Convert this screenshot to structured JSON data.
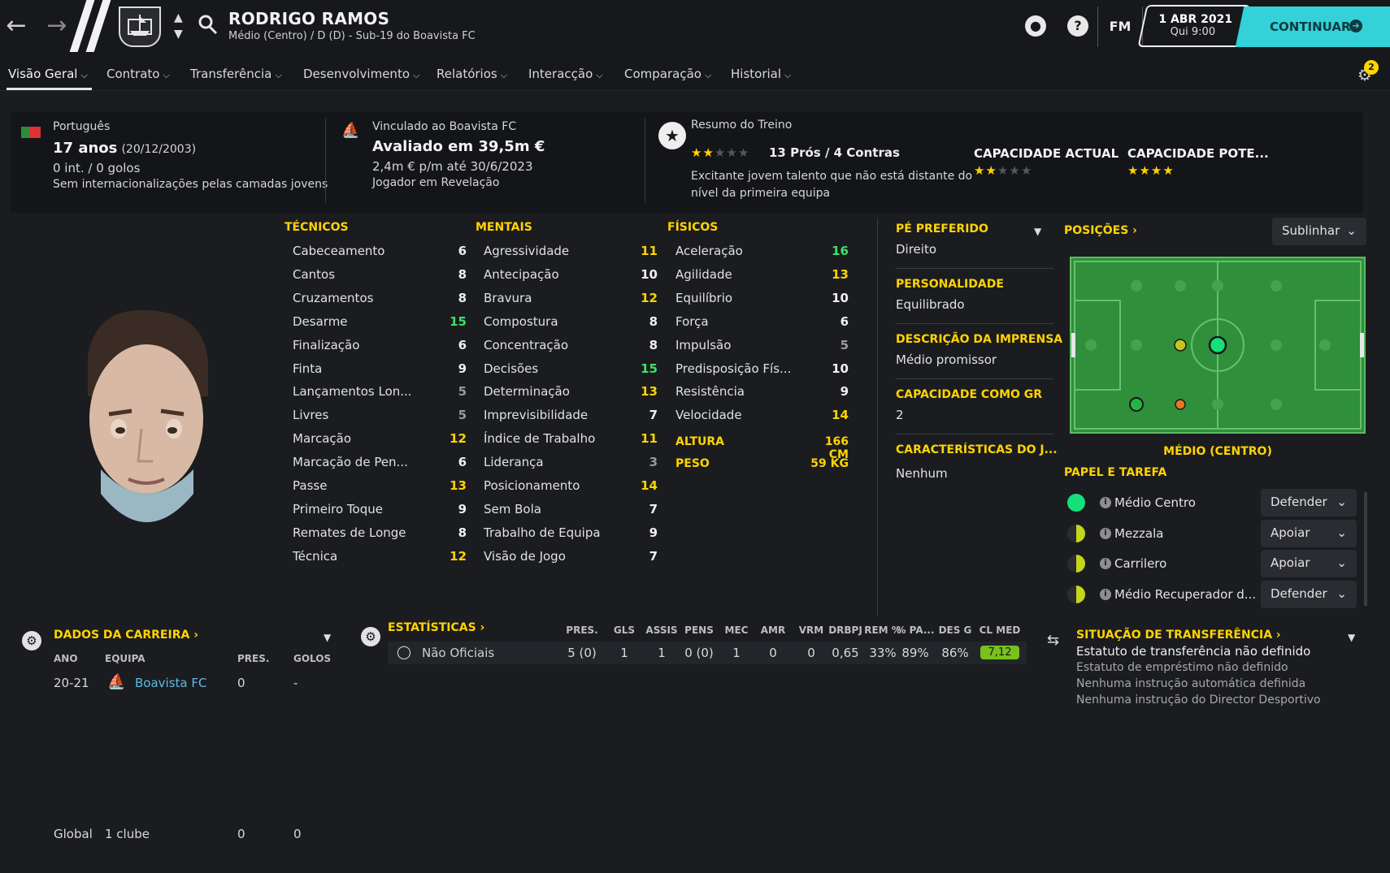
{
  "header": {
    "player_name": "RODRIGO RAMOS",
    "player_subtitle": "Médio (Centro) / D (D) - Sub-19 do Boavista FC",
    "date_main": "1 ABR 2021",
    "date_sub": "Qui 9:00",
    "continue_label": "CONTINUAR",
    "fm_label": "FM",
    "help_label": "?"
  },
  "tabs": [
    {
      "label": "Visão Geral"
    },
    {
      "label": "Contrato"
    },
    {
      "label": "Transferência"
    },
    {
      "label": "Desenvolvimento"
    },
    {
      "label": "Relatórios"
    },
    {
      "label": "Interacção"
    },
    {
      "label": "Comparação"
    },
    {
      "label": "Historial"
    }
  ],
  "notifications": "2",
  "summary": {
    "nationality": "Português",
    "age": "17 anos",
    "dob": "(20/12/2003)",
    "caps": "0 int. / 0 golos",
    "youth_caps": "Sem internacionalizações pelas camadas jovens",
    "club_link": "Vinculado ao Boavista FC",
    "value": "Avaliado em 39,5m €",
    "wage": "2,4m € p/m até 30/6/2023",
    "status": "Jogador em Revelação",
    "training_title": "Resumo do Treino",
    "pros_cons": "13 Prós / 4 Contras",
    "training_desc_1": "Excitante jovem talento que não está distante do",
    "training_desc_2": "nível da primeira equipa",
    "training_stars": 2,
    "current_ability_label": "CAPACIDADE ACTUAL",
    "current_ability_stars": 2,
    "potential_ability_label": "CAPACIDADE POTE...",
    "potential_ability_stars": 4
  },
  "attributes": {
    "technical_title": "TÉCNICOS",
    "technical": [
      {
        "name": "Cabeceamento",
        "value": "6"
      },
      {
        "name": "Cantos",
        "value": "8"
      },
      {
        "name": "Cruzamentos",
        "value": "8"
      },
      {
        "name": "Desarme",
        "value": "15"
      },
      {
        "name": "Finalização",
        "value": "6"
      },
      {
        "name": "Finta",
        "value": "9"
      },
      {
        "name": "Lançamentos Lon...",
        "value": "5"
      },
      {
        "name": "Livres",
        "value": "5"
      },
      {
        "name": "Marcação",
        "value": "12"
      },
      {
        "name": "Marcação de Pen...",
        "value": "6"
      },
      {
        "name": "Passe",
        "value": "13"
      },
      {
        "name": "Primeiro Toque",
        "value": "9"
      },
      {
        "name": "Remates de Longe",
        "value": "8"
      },
      {
        "name": "Técnica",
        "value": "12"
      }
    ],
    "mental_title": "MENTAIS",
    "mental": [
      {
        "name": "Agressividade",
        "value": "11"
      },
      {
        "name": "Antecipação",
        "value": "10"
      },
      {
        "name": "Bravura",
        "value": "12"
      },
      {
        "name": "Compostura",
        "value": "8"
      },
      {
        "name": "Concentração",
        "value": "8"
      },
      {
        "name": "Decisões",
        "value": "15"
      },
      {
        "name": "Determinação",
        "value": "13"
      },
      {
        "name": "Imprevisibilidade",
        "value": "7"
      },
      {
        "name": "Índice de Trabalho",
        "value": "11"
      },
      {
        "name": "Liderança",
        "value": "3"
      },
      {
        "name": "Posicionamento",
        "value": "14"
      },
      {
        "name": "Sem Bola",
        "value": "7"
      },
      {
        "name": "Trabalho de Equipa",
        "value": "9"
      },
      {
        "name": "Visão de Jogo",
        "value": "7"
      }
    ],
    "physical_title": "FÍSICOS",
    "physical": [
      {
        "name": "Aceleração",
        "value": "16"
      },
      {
        "name": "Agilidade",
        "value": "13"
      },
      {
        "name": "Equilíbrio",
        "value": "10"
      },
      {
        "name": "Força",
        "value": "6"
      },
      {
        "name": "Impulsão",
        "value": "5"
      },
      {
        "name": "Predisposição Fís...",
        "value": "10"
      },
      {
        "name": "Resistência",
        "value": "9"
      },
      {
        "name": "Velocidade",
        "value": "14"
      }
    ],
    "height_label": "ALTURA",
    "height_value": "166 CM",
    "weight_label": "PESO",
    "weight_value": "59 KG",
    "colors": {
      "high": "#3ee06a",
      "good": "#ffd400",
      "mid": "#f0f0f0",
      "low": "#9a9a9a"
    }
  },
  "profile": {
    "preferred_foot_label": "PÉ PREFERIDO",
    "preferred_foot_value": "Direito",
    "personality_label": "PERSONALIDADE",
    "personality_value": "Equilibrado",
    "press_label": "DESCRIÇÃO DA IMPRENSA",
    "press_value": "Médio promissor",
    "gk_label": "CAPACIDADE COMO GR",
    "gk_value": "2",
    "traits_label": "CARACTERÍSTICAS DO J...",
    "traits_value": "Nenhum"
  },
  "positions": {
    "title": "POSIÇÕES",
    "highlight_select": "Sublinhar",
    "position_label": "MÉDIO (CENTRO)",
    "roles_title": "PAPEL E TAREFA",
    "roles": [
      {
        "name": "Médio Centro",
        "duty": "Defender"
      },
      {
        "name": "Mezzala",
        "duty": "Apoiar"
      },
      {
        "name": "Carrilero",
        "duty": "Apoiar"
      },
      {
        "name": "Médio Recuperador d...",
        "duty": "Defender"
      }
    ]
  },
  "career": {
    "title": "DADOS DA CARREIRA",
    "col_year": "ANO",
    "col_team": "EQUIPA",
    "col_apps": "PRES.",
    "col_goals": "GOLOS",
    "rows": [
      {
        "year": "20-21",
        "team": "Boavista FC",
        "apps": "0",
        "goals": "-"
      }
    ],
    "total_label": "Global",
    "total_clubs": "1 clube",
    "total_apps": "0",
    "total_goals": "0"
  },
  "stats": {
    "title": "ESTATÍSTICAS",
    "columns": [
      "PRES.",
      "GLS",
      "ASSIS",
      "PENS",
      "MEC",
      "AMR",
      "VRM",
      "DRBPJ",
      "REM %",
      "% PA...",
      "DES G",
      "CL MED"
    ],
    "row_label": "Não Oficiais",
    "row_values": [
      "5 (0)",
      "1",
      "1",
      "0 (0)",
      "1",
      "0",
      "0",
      "0,65",
      "33%",
      "89%",
      "86%",
      "7,12"
    ]
  },
  "transfer": {
    "title": "SITUAÇÃO DE TRANSFERÊNCIA",
    "status": "Estatuto de transferência não definido",
    "loan": "Estatuto de empréstimo não definido",
    "auto": "Nenhuma instrução automática definida",
    "director": "Nenhuma instrução do Director Desportivo"
  }
}
